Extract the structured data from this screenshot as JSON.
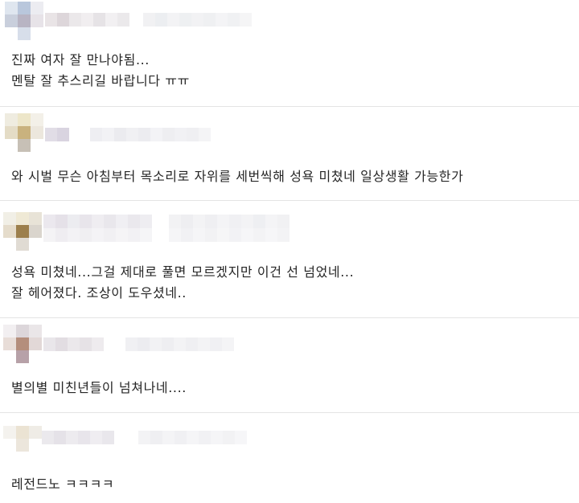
{
  "comments": [
    {
      "lines": [
        "진짜 여자 잘 만나야됨...",
        "멘탈 잘 추스리길 바랍니다 ㅠㅠ"
      ]
    },
    {
      "lines": [
        "와 시벌 무슨 아침부터 목소리로 자위를 세번씩해 성욕 미쳤네 일상생활 가능한가"
      ]
    },
    {
      "lines": [
        "성욕 미쳤네...그걸 제대로 풀면 모르겠지만 이건 선 넘었네...",
        "잘 헤어졌다. 조상이 도우셨네.."
      ]
    },
    {
      "lines": [
        "별의별 미친년들이 넘쳐나네...."
      ]
    },
    {
      "lines": [
        "레전드노 ㅋㅋㅋㅋ"
      ]
    }
  ],
  "colors": {
    "divider": "#e4e4e4",
    "text": "#262626",
    "background": "#ffffff"
  }
}
